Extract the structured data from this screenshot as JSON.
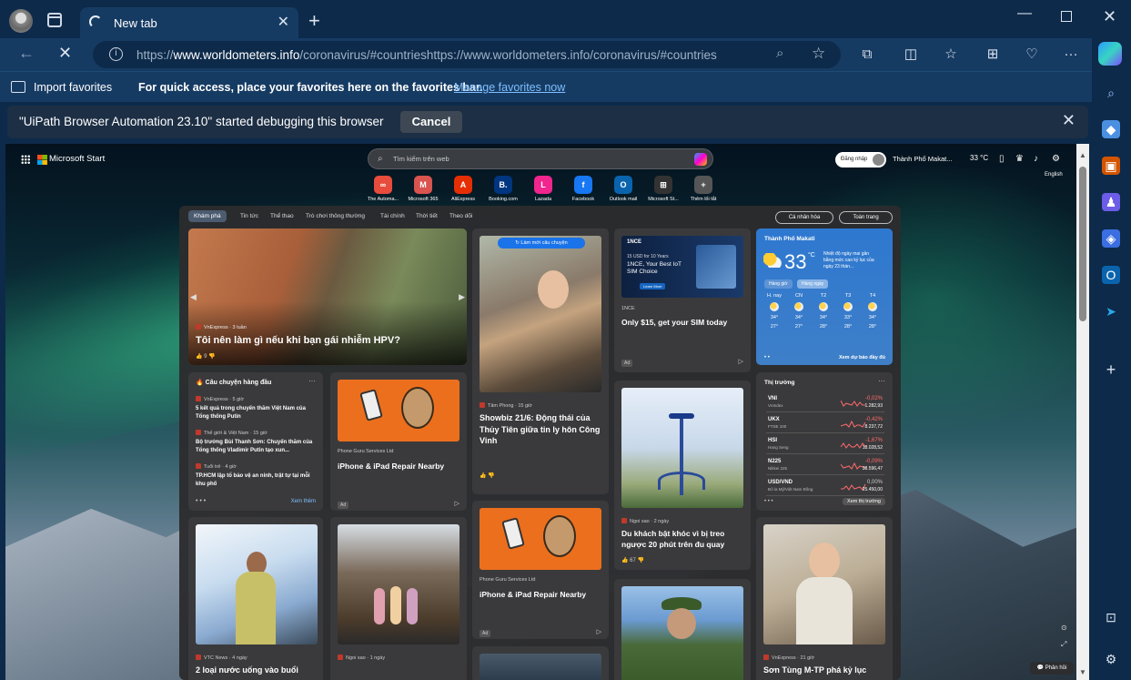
{
  "browser": {
    "tab_title": "New tab",
    "url_host": "www.worldometers.info",
    "url_prefix": "https://",
    "url_path": "/coronavirus/#countrieshttps://www.worldometers.info/coronavirus/#countries",
    "import_favorites": "Import favorites",
    "favbar_message": "For quick access, place your favorites here on the favorites bar.",
    "manage_favorites": "Manage favorites now",
    "debug_message": "\"UiPath Browser Automation 23.10\" started debugging this browser",
    "cancel_label": "Cancel"
  },
  "colors": {
    "toolbar": "#163b63",
    "frame": "#0d2a4a",
    "accent_link": "#7fbfff"
  },
  "msstart": {
    "logo_text": "Microsoft Start",
    "search_placeholder": "Tìm kiếm trên web",
    "login_label": "Đăng nhập",
    "location": "Thành Phố Makat...",
    "temp": "33 °C",
    "language": "English",
    "quick_links": [
      {
        "label": "The Automa...",
        "icon": "∞",
        "color": "#e74c3c"
      },
      {
        "label": "Microsoft 365",
        "icon": "M",
        "color": "#d9534f"
      },
      {
        "label": "AliExpress",
        "icon": "A",
        "color": "#e62e04"
      },
      {
        "label": "Booking.com",
        "icon": "B.",
        "color": "#003580"
      },
      {
        "label": "Lazada",
        "icon": "L",
        "color": "#f0258e"
      },
      {
        "label": "Facebook",
        "icon": "f",
        "color": "#1877f2"
      },
      {
        "label": "Outlook mail",
        "icon": "O",
        "color": "#0a64ad"
      },
      {
        "label": "Microsoft St...",
        "icon": "⊞",
        "color": "#333"
      },
      {
        "label": "Thêm lối tắt",
        "icon": "+",
        "color": "#555"
      }
    ],
    "tabs": [
      "Khám phá",
      "Tin tức",
      "Thể thao",
      "Trò chơi thông thường",
      "Tài chính",
      "Thời tiết",
      "Theo dõi"
    ],
    "personalize": "Cá nhân hóa",
    "all_pages": "Toàn trang",
    "hero": {
      "source": "VnExpress · 3 tuần",
      "headline": "Tôi nên làm gì nếu khi bạn gái nhiễm HPV?",
      "likes": "9"
    },
    "top_stories": {
      "title": "Câu chuyện hàng đầu",
      "items": [
        {
          "source": "VnExpress · 5 giờ",
          "headline": "5 kết quả trong chuyến thăm Việt Nam của Tổng thống Putin"
        },
        {
          "source": "Thế giới & Việt Nam · 15 giờ",
          "headline": "Bộ trưởng Bùi Thanh Sơn: Chuyến thăm của Tổng thống Vladimir Putin tạo xun..."
        },
        {
          "source": "Tuổi trẻ · 4 giờ",
          "headline": "TP.HCM lập tổ bảo vệ an ninh, trật tự tại mỗi khu phố"
        }
      ],
      "see_more": "Xem thêm"
    },
    "ad1": {
      "source": "Phone Guru Services Ltd",
      "headline": "iPhone & iPad Repair Nearby",
      "ad": "Ad"
    },
    "ad2": {
      "source": "Phone Guru Services Ltd",
      "headline": "iPhone & iPad Repair Nearby",
      "ad": "Ad"
    },
    "refresh_btn": "Làm mới câu chuyện",
    "showbiz": {
      "source": "Tâm Phong · 15 giờ",
      "headline": "Showbiz 21/6: Động thái của Thủy Tiên giữa tin ly hôn Công Vinh"
    },
    "sim": {
      "ad_head": "15 USD for 10 Years",
      "ad_title": "1NCE, Your Best IoT SIM Choice",
      "ad_btn": "Learn More",
      "brand": "1NCE",
      "source": "1NCE",
      "headline": "Only $15, get your SIM today",
      "ad": "Ad"
    },
    "ride": {
      "source": "Ngoi sao · 2 ngày",
      "headline": "Du khách bật khóc vì bị treo ngược 20 phút trên đu quay",
      "likes": "67"
    },
    "water": {
      "source": "VTC News · 4 ngày",
      "headline": "2 loại nước uống vào buổi"
    },
    "kyoto": {
      "source": "Ngoi sao · 1 ngày"
    },
    "son_tung": {
      "source": "VnExpress · 21 giờ",
      "headline": "Sơn Tùng M-TP phá kỷ lục"
    },
    "weather": {
      "city": "Thành Phố Makati",
      "temp": "33",
      "unit": "°C",
      "alert": "Nhiệt độ ngày mai gần bằng mức cao kỷ lục của ngày 23 thán...",
      "tab_hourly": "Hàng giờ",
      "tab_daily": "Hàng ngày",
      "days": [
        {
          "d": "H. nay",
          "hi": "34°",
          "lo": "27°"
        },
        {
          "d": "CN",
          "hi": "34°",
          "lo": "27°"
        },
        {
          "d": "T2",
          "hi": "34°",
          "lo": "28°"
        },
        {
          "d": "T3",
          "hi": "33°",
          "lo": "28°"
        },
        {
          "d": "T4",
          "hi": "34°",
          "lo": "28°"
        }
      ],
      "full_forecast": "Xem dự báo đầy đủ"
    },
    "market": {
      "title": "Thị trường",
      "rows": [
        {
          "n": "VNI",
          "s": "VnIndex",
          "c": "-0,02%",
          "v": "1.282,93"
        },
        {
          "n": "UKX",
          "s": "FTSE 100",
          "c": "-0,42%",
          "v": "8.237,72"
        },
        {
          "n": "HSI",
          "s": "Hang Seng",
          "c": "-1,67%",
          "v": "18.028,52"
        },
        {
          "n": "N225",
          "s": "Nikkei 225",
          "c": "-0,09%",
          "v": "38.596,47"
        },
        {
          "n": "USD/VND",
          "s": "Đô la Mỹ/Việt Nam Đồng",
          "c": "0,00%",
          "v": "25.450,00"
        }
      ],
      "see_market": "Xem thị trường"
    },
    "feedback": "Phản hồi"
  }
}
